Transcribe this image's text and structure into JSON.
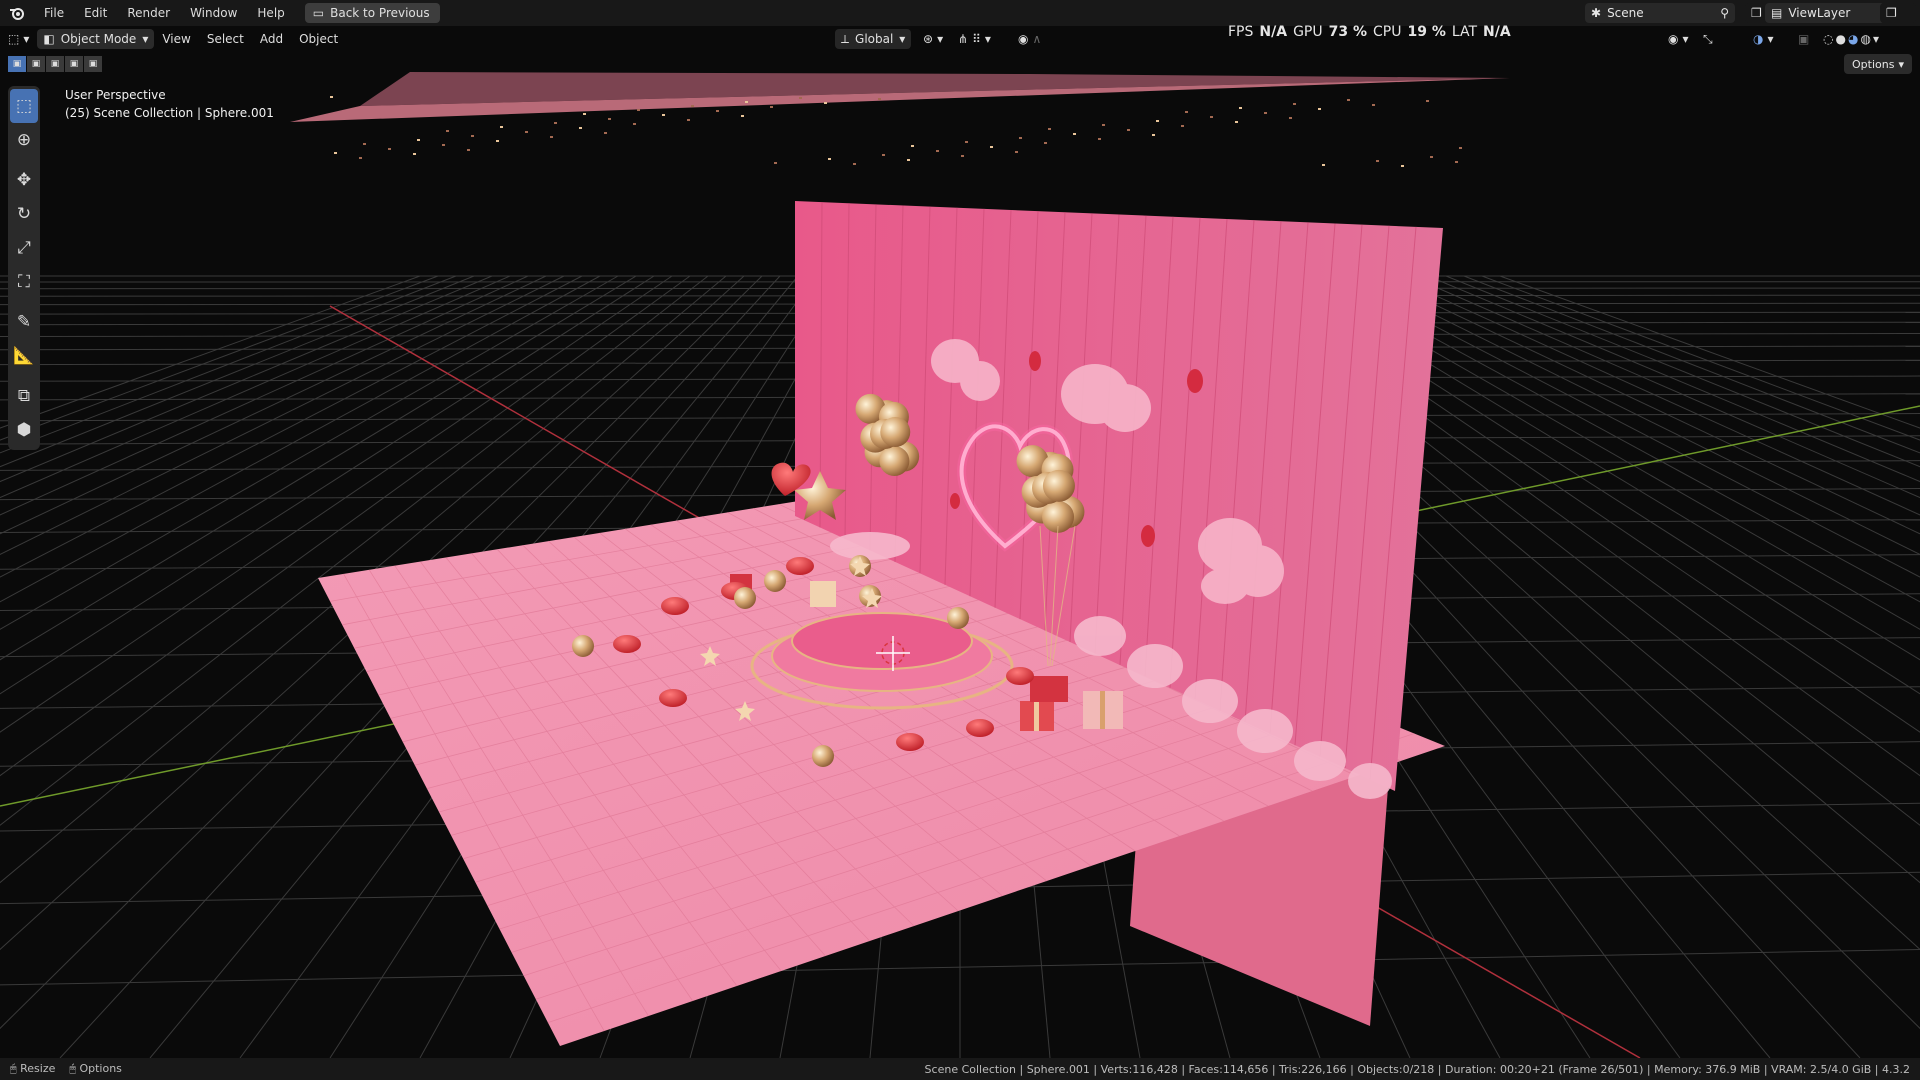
{
  "menu": {
    "items": [
      "File",
      "Edit",
      "Render",
      "Window",
      "Help"
    ],
    "back_button": "Back to Previous"
  },
  "scene_selector": {
    "label": "Scene"
  },
  "viewlayer_selector": {
    "label": "ViewLayer"
  },
  "viewport_header": {
    "mode": "Object Mode",
    "menus": [
      "View",
      "Select",
      "Add",
      "Object"
    ],
    "transform_orientation": "Global",
    "options_label": "Options"
  },
  "perf": {
    "fps_label": "FPS",
    "fps_value": "N/A",
    "gpu_label": "GPU",
    "gpu_value": "73 %",
    "cpu_label": "CPU",
    "cpu_value": "19 %",
    "lat_label": "LAT",
    "lat_value": "N/A"
  },
  "viewport_info": {
    "perspective": "User Perspective",
    "collection": "(25) Scene Collection | Sphere.001"
  },
  "toolbar": {
    "tools": [
      "select-box",
      "cursor",
      "move",
      "rotate",
      "scale",
      "transform",
      "annotate",
      "measure",
      "add-cube",
      "add-object"
    ]
  },
  "statusbar": {
    "resize_label": "Resize",
    "options_label": "Options",
    "stats": "Scene Collection | Sphere.001 | Verts:116,428 | Faces:114,656 | Tris:226,166 | Objects:0/218 | Duration: 00:20+21 (Frame 26/501) | Memory: 376.9 MiB | VRAM: 2.5/4.0 GiB | 4.3.2"
  },
  "colors": {
    "accent": "#4772b3",
    "floor": "#f08aa8",
    "wall": "#e35d86",
    "grid": "#3a3a3a",
    "x_axis": "#b0303c",
    "y_axis": "#6f9a2a"
  }
}
